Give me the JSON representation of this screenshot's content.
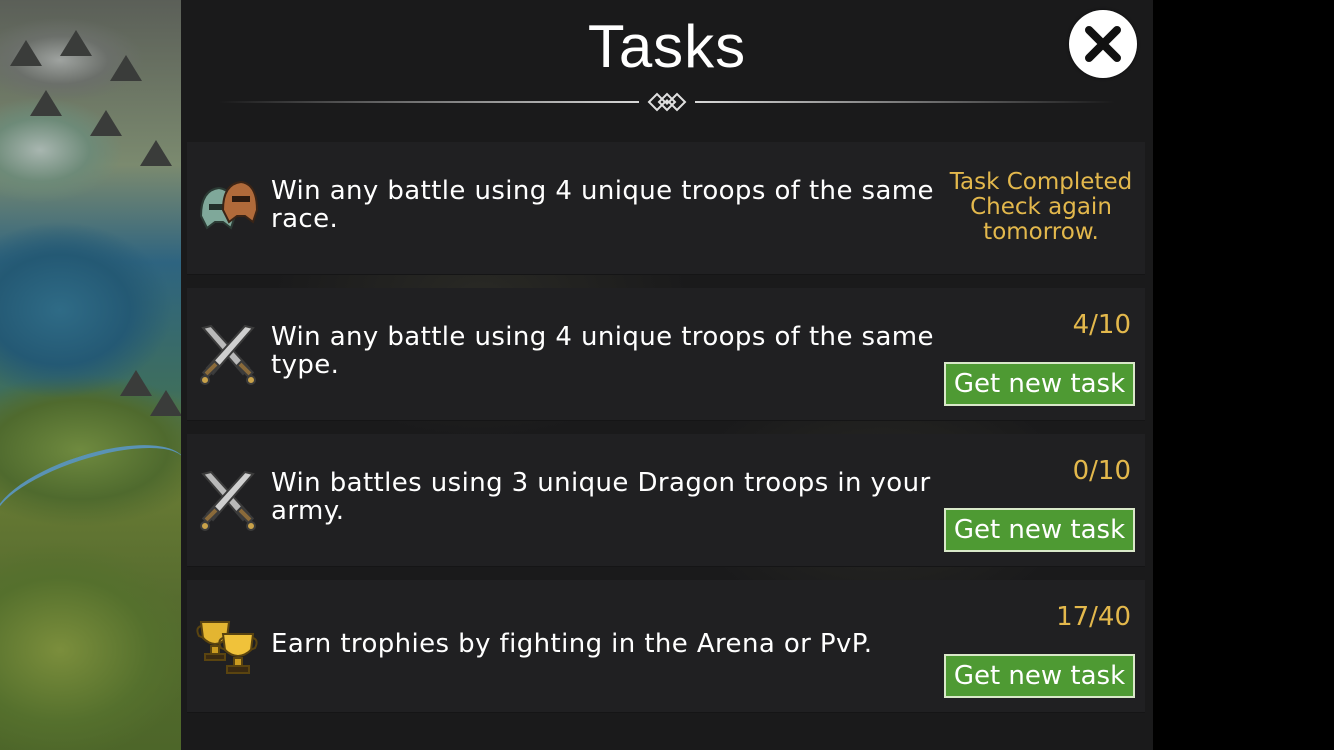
{
  "title": "Tasks",
  "close_icon": "close-icon",
  "colors": {
    "panel_bg": "#1a1a1b",
    "row_bg": "#202022",
    "accent_gold": "#e3b84c",
    "button_green": "#4e9a33"
  },
  "tasks": [
    {
      "icon": "helmets-icon",
      "description": "Win any battle using 4 unique troops of the same race.",
      "status_lines": [
        "Task Completed",
        "Check again",
        "tomorrow."
      ],
      "completed": true
    },
    {
      "icon": "crossed-swords-icon",
      "description": "Win any battle using 4 unique troops of the same type.",
      "progress": "4/10",
      "button_label": "Get new task"
    },
    {
      "icon": "crossed-swords-icon",
      "description": "Win battles using 3 unique Dragon troops in your army.",
      "progress": "0/10",
      "button_label": "Get new task"
    },
    {
      "icon": "trophies-icon",
      "description": "Earn trophies by fighting in the Arena or PvP.",
      "progress": "17/40",
      "button_label": "Get new task"
    }
  ]
}
